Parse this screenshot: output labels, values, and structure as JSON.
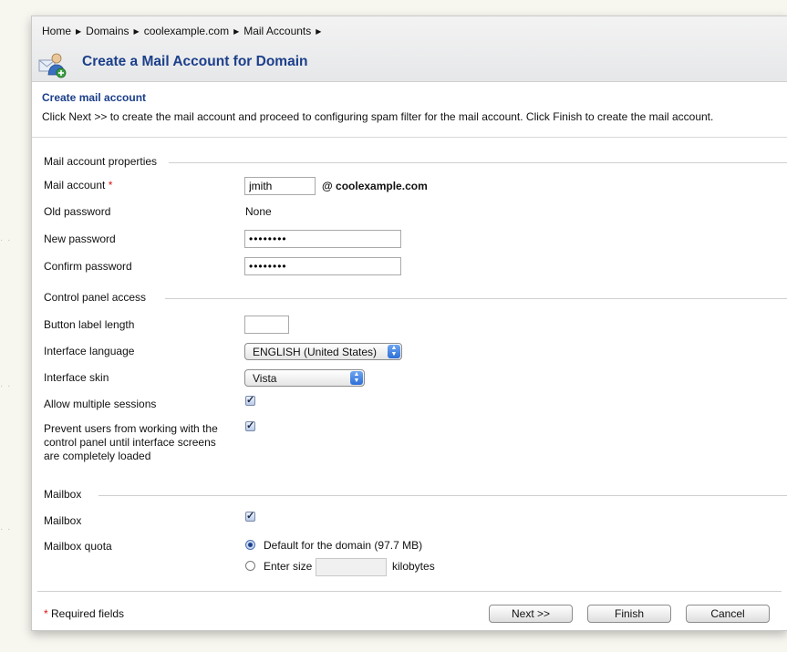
{
  "breadcrumb": {
    "items": [
      "Home",
      "Domains",
      "coolexample.com",
      "Mail Accounts"
    ]
  },
  "header": {
    "title": "Create a Mail Account for Domain",
    "icon": "mail-user-add-icon"
  },
  "intro": {
    "heading": "Create mail account",
    "text": "Click Next >> to create the mail account and proceed to configuring spam filter for the mail account. Click Finish to create the mail account."
  },
  "mail_properties": {
    "section_title": "Mail account properties",
    "mail_account_label": "Mail account",
    "required_marker": "*",
    "mail_account_value": "jmith",
    "domain_suffix": "@ coolexample.com",
    "old_password_label": "Old password",
    "old_password_value": "None",
    "new_password_label": "New password",
    "new_password_value": "••••••••",
    "confirm_password_label": "Confirm password",
    "confirm_password_value": "••••••••"
  },
  "control_panel": {
    "section_title": "Control panel access",
    "button_label_length_label": "Button label length",
    "button_label_length_value": "",
    "interface_language_label": "Interface language",
    "interface_language_value": "ENGLISH (United States)",
    "interface_skin_label": "Interface skin",
    "interface_skin_value": "Vista",
    "allow_multiple_sessions_label": "Allow multiple sessions",
    "allow_multiple_sessions_checked": true,
    "prevent_users_label_line1": "Prevent users from working with the",
    "prevent_users_label_line2": "control panel until interface screens",
    "prevent_users_label_line3": "are completely loaded",
    "prevent_users_checked": true
  },
  "mailbox": {
    "section_title": "Mailbox",
    "mailbox_label": "Mailbox",
    "mailbox_checked": true,
    "quota_label": "Mailbox quota",
    "quota_default_label": "Default for the domain (97.7 MB)",
    "quota_enter_label": "Enter size",
    "quota_size_value": "",
    "quota_unit": "kilobytes",
    "selected_option": "default"
  },
  "footer": {
    "required_note": "* Required fields",
    "next_label": "Next >>",
    "finish_label": "Finish",
    "cancel_label": "Cancel"
  },
  "colors": {
    "title_blue": "#1b3f8a",
    "required_red": "#d11111"
  }
}
